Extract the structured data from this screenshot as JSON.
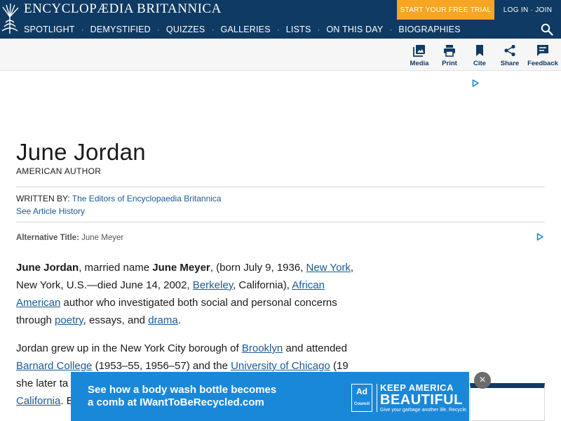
{
  "header": {
    "brand": "ENCYCLOPÆDIA BRITANNICA",
    "trial_button": "START YOUR FREE TRIAL",
    "login": "LOG IN · JOIN",
    "nav": [
      "SPOTLIGHT",
      "DEMYSTIFIED",
      "QUIZZES",
      "GALLERIES",
      "LISTS",
      "ON THIS DAY",
      "BIOGRAPHIES"
    ],
    "nav_separator": "·"
  },
  "toolbar": {
    "media": "Media",
    "print": "Print",
    "cite": "Cite",
    "share": "Share",
    "feedback": "Feedback"
  },
  "article": {
    "title": "June Jordan",
    "subtitle": "AMERICAN AUTHOR",
    "written_by_label": "WRITTEN BY:",
    "author": "The Editors of Encyclopaedia Britannica",
    "history_link": "See Article History",
    "alt_title_label": "Alternative Title:",
    "alt_title_value": "June Meyer",
    "p1": {
      "bold1": "June Jordan",
      "t1": ", married name ",
      "bold2": "June Meyer",
      "t2": ", (born July 9, 1936, ",
      "link1": "New York",
      "t3": ", New York, U.S.—died June 14, 2002, ",
      "link2": "Berkeley",
      "t4": ", California), ",
      "link3": "African American",
      "t5": " author who investigated both social and personal concerns through ",
      "link4": "poetry",
      "t6": ", essays, and ",
      "link5": "drama",
      "t7": "."
    },
    "p2": {
      "t1": "Jordan grew up in the New York City borough of ",
      "link1": "Brooklyn",
      "t2": " and attended ",
      "link2": "Barnard College",
      "t3": " (1953–55, 1956–57) and the ",
      "link3": "University of Chicago",
      "t4": " (19",
      "t5": "she later ta",
      "link4": "California",
      "t6": ". B"
    }
  },
  "ad": {
    "line1": "See how a body wash bottle becomes",
    "line2": "a comb at IWantToBeRecycled.com",
    "logo_top": "Ad",
    "logo_bottom": "Council",
    "headline1": "KEEP AMERICA",
    "headline2": "BEAUTIFUL",
    "tagline": "Give your garbage another life. Recycle.",
    "close": "×",
    "color": "#1a88d8"
  },
  "colors": {
    "header_bg": "#0f3a63",
    "trial_bg": "#f6a623",
    "link": "#1a5a96"
  }
}
